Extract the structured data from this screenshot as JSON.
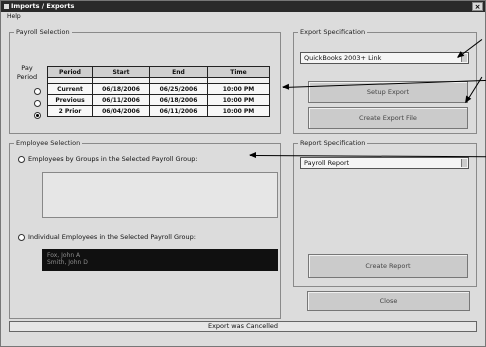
{
  "window": {
    "title": "Imports / Exports",
    "close_glyph": "×"
  },
  "menu": {
    "items": [
      "Help"
    ]
  },
  "payroll_selection": {
    "legend": "Payroll Selection",
    "pay_period_label": "Pay Period",
    "columns": [
      "Period",
      "Start",
      "End",
      "Time"
    ],
    "rows": [
      {
        "period": "Current",
        "start": "06/18/2006",
        "end": "06/25/2006",
        "time": "10:00 PM",
        "selected": false
      },
      {
        "period": "Previous",
        "start": "06/11/2006",
        "end": "06/18/2006",
        "time": "10:00 PM",
        "selected": false
      },
      {
        "period": "2 Prior",
        "start": "06/04/2006",
        "end": "06/11/2006",
        "time": "10:00 PM",
        "selected": true
      }
    ]
  },
  "employee_selection": {
    "legend": "Employee Selection",
    "option_groups": "Employees by Groups in the Selected Payroll Group:",
    "option_individual": "Individual Employees in the Selected Payroll Group:",
    "individual_list": [
      "Fox, John A",
      "Smith, John D"
    ]
  },
  "export_specification": {
    "legend": "Export Specification",
    "selected": "QuickBooks 2003+ Link",
    "setup_button": "Setup Export",
    "create_button": "Create Export File"
  },
  "report_specification": {
    "legend": "Report Specification",
    "selected": "Payroll Report",
    "create_button": "Create Report"
  },
  "close_button": "Close",
  "status": "Export was Cancelled"
}
